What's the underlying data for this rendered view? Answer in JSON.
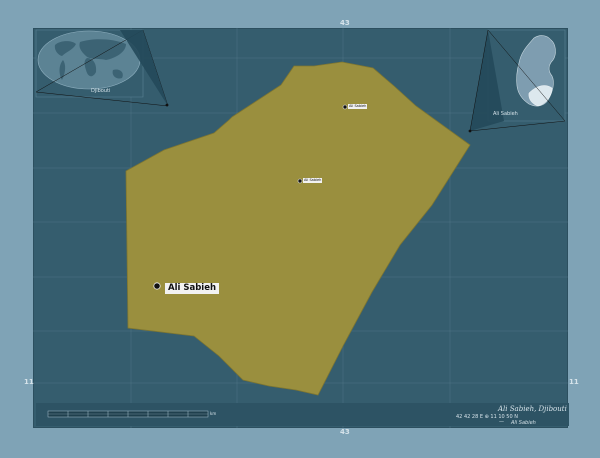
{
  "map": {
    "region_name": "Ali Sabieh",
    "country": "Djibouti",
    "inset_world_label": "Djibouti",
    "inset_country_label": "Ali Sabieh",
    "main_label": "Ali Sabieh",
    "small_labels": [
      "Ali Sabieh",
      "Ali Sabieh"
    ],
    "colors": {
      "background": "#7fa3b6",
      "sea": "#355d6e",
      "region_fill": "#9a8f3e",
      "inset_country": "#7e9db0",
      "inset_highlight": "#dce8ee"
    }
  },
  "axes": {
    "top_center": "43",
    "left_bottom": "11",
    "right_bottom": "11",
    "bottom_center": "43"
  },
  "scale": {
    "unit": "km"
  },
  "caption": {
    "title": "Ali Sabieh, Djibouti",
    "coordinates": "42 42 28 E ⊕ 11 10 50 N",
    "legend_label": "Ali Sabieh"
  }
}
